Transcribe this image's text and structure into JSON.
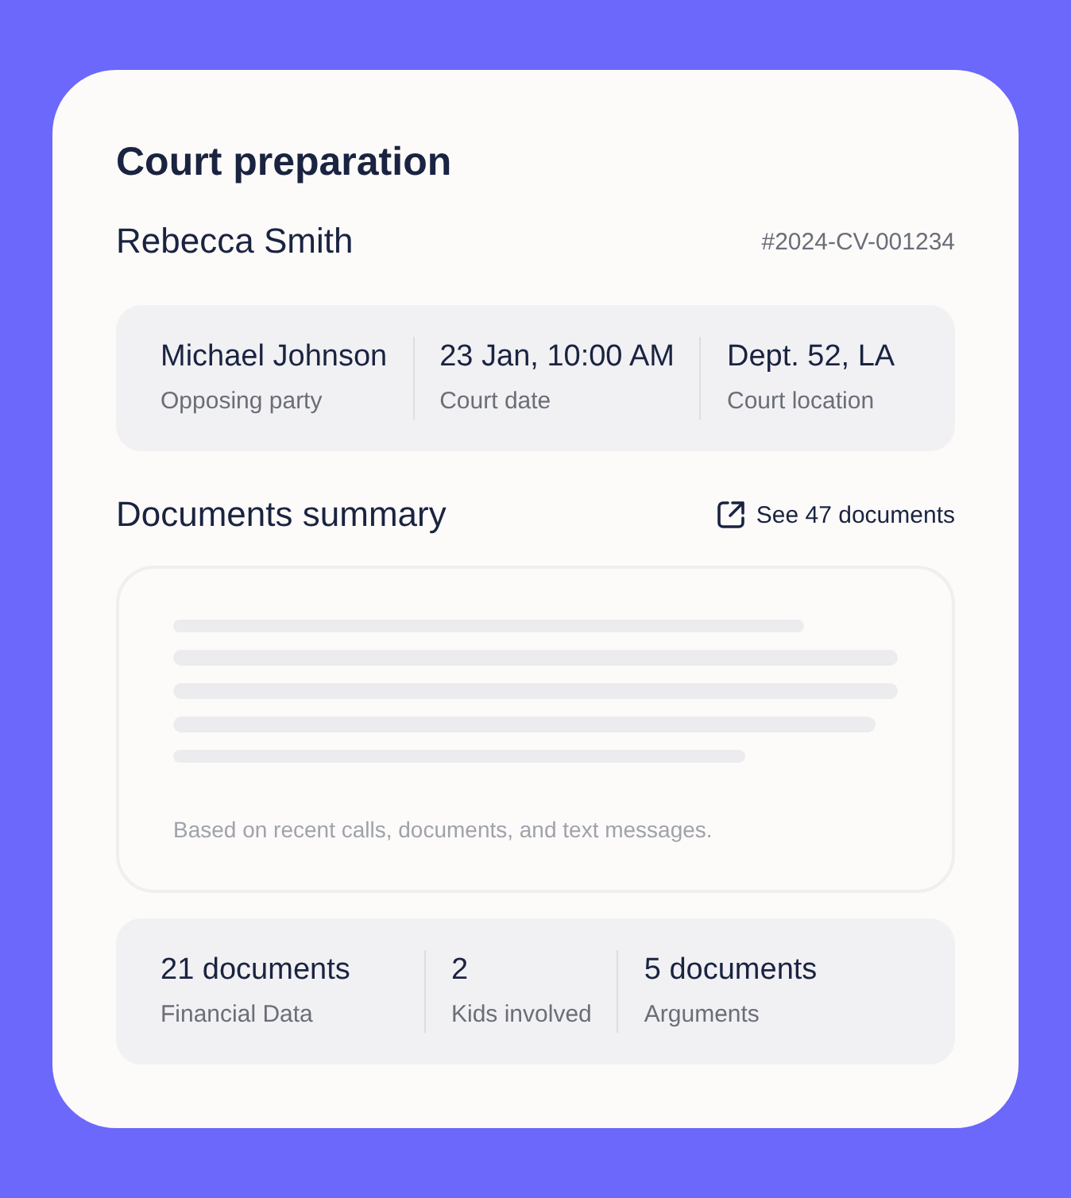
{
  "title": "Court preparation",
  "client": {
    "name": "Rebecca Smith",
    "case_number": "#2024-CV-001234"
  },
  "details": [
    {
      "value": "Michael Johnson",
      "label": "Opposing party"
    },
    {
      "value": "23 Jan, 10:00 AM",
      "label": "Court date"
    },
    {
      "value": "Dept. 52, LA",
      "label": "Court location"
    }
  ],
  "documents": {
    "heading": "Documents summary",
    "link": "See 47 documents",
    "note": "Based on recent calls, documents, and text messages."
  },
  "stats": [
    {
      "value": "21 documents",
      "label": "Financial Data"
    },
    {
      "value": "2",
      "label": "Kids involved"
    },
    {
      "value": "5 documents",
      "label": "Arguments"
    }
  ]
}
